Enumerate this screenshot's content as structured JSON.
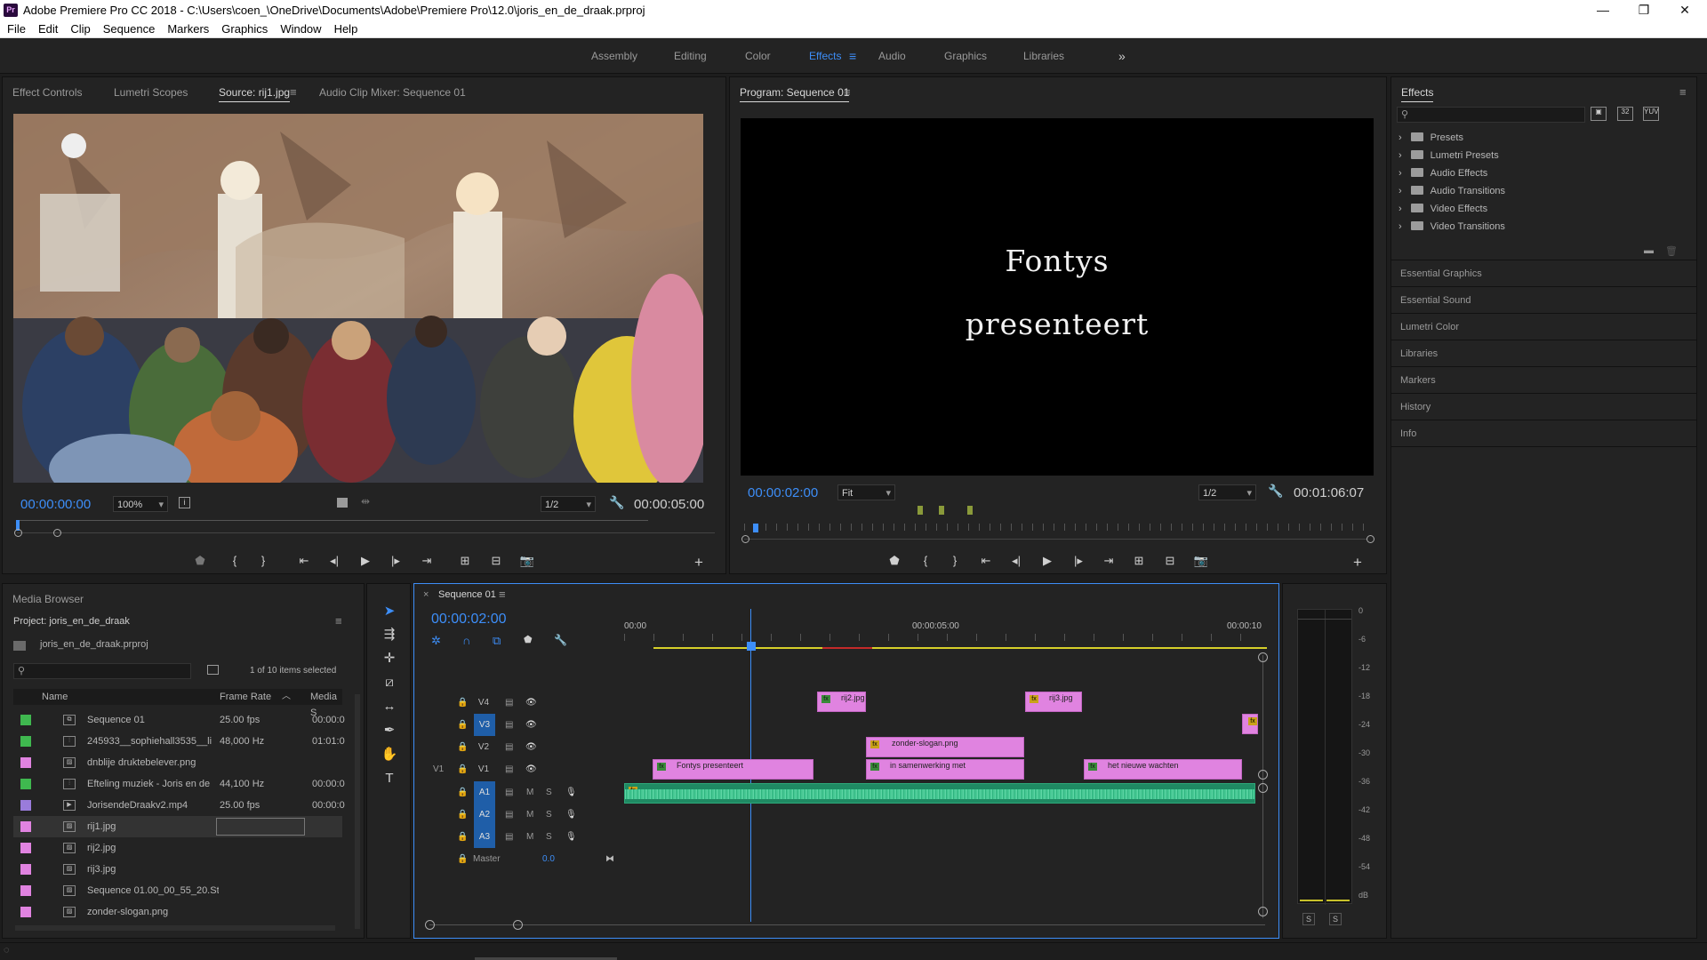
{
  "app": {
    "title": "Adobe Premiere Pro CC 2018 - C:\\Users\\coen_\\OneDrive\\Documents\\Adobe\\Premiere Pro\\12.0\\joris_en_de_draak.prproj",
    "icon_text": "Pr",
    "minimize": "—",
    "maximize": "❐",
    "close": "✕"
  },
  "menu": [
    "File",
    "Edit",
    "Clip",
    "Sequence",
    "Markers",
    "Graphics",
    "Window",
    "Help"
  ],
  "workspaces": [
    "Assembly",
    "Editing",
    "Color",
    "Effects",
    "Audio",
    "Graphics",
    "Libraries"
  ],
  "workspace_active": "Effects",
  "workspace_more": "»",
  "source": {
    "tabs": [
      "Effect Controls",
      "Lumetri Scopes",
      "Source: rij1.jpg",
      "Audio Clip Mixer: Sequence 01"
    ],
    "active_tab": "Source: rij1.jpg",
    "timecode": "00:00:00:00",
    "zoom": "100%",
    "resolution": "1/2",
    "duration": "00:00:05:00"
  },
  "program": {
    "tab": "Program: Sequence 01",
    "line1": "Fontys",
    "line2": "presenteert",
    "timecode": "00:00:02:00",
    "fit": "Fit",
    "resolution": "1/2",
    "duration": "00:01:06:07"
  },
  "effects": {
    "title": "Effects",
    "tree": [
      "Presets",
      "Lumetri Presets",
      "Audio Effects",
      "Audio Transitions",
      "Video Effects",
      "Video Transitions"
    ],
    "sections": [
      "Essential Graphics",
      "Essential Sound",
      "Lumetri Color",
      "Libraries",
      "Markers",
      "History",
      "Info"
    ]
  },
  "project": {
    "tab1": "Media Browser",
    "title": "Project: joris_en_de_draak",
    "file": "joris_en_de_draak.prproj",
    "selected": "1 of 10 items selected",
    "columns": [
      "Name",
      "Frame Rate",
      "Media S"
    ],
    "items": [
      {
        "name": "Sequence 01",
        "rate": "25.00 fps",
        "start": "00:00:0",
        "color": "#3fb84f",
        "icon": "seq"
      },
      {
        "name": "245933__sophiehall3535__li",
        "rate": "48,000 Hz",
        "start": "01:01:0",
        "color": "#3fb84f",
        "icon": "aud"
      },
      {
        "name": "dnblije druktebelever.png",
        "rate": "",
        "start": "",
        "color": "#e083e0",
        "icon": "img"
      },
      {
        "name": "Efteling muziek - Joris en de",
        "rate": "44,100 Hz",
        "start": "00:00:0",
        "color": "#3fb84f",
        "icon": "aud"
      },
      {
        "name": "JorisendeDraakv2.mp4",
        "rate": "25.00 fps",
        "start": "00:00:0",
        "color": "#9a7cdb",
        "icon": "vid"
      },
      {
        "name": "rij1.jpg",
        "rate": "",
        "start": "",
        "color": "#e083e0",
        "icon": "img"
      },
      {
        "name": "rij2.jpg",
        "rate": "",
        "start": "",
        "color": "#e083e0",
        "icon": "img"
      },
      {
        "name": "rij3.jpg",
        "rate": "",
        "start": "",
        "color": "#e083e0",
        "icon": "img"
      },
      {
        "name": "Sequence 01.00_00_55_20.St",
        "rate": "",
        "start": "",
        "color": "#e083e0",
        "icon": "img"
      },
      {
        "name": "zonder-slogan.png",
        "rate": "",
        "start": "",
        "color": "#e083e0",
        "icon": "img"
      }
    ]
  },
  "timeline": {
    "tab": "Sequence 01",
    "timecode": "00:00:02:00",
    "ruler": [
      "00:00",
      "00:00:05:00",
      "00:00:10"
    ],
    "video_tracks": [
      "V4",
      "V3",
      "V2",
      "V1"
    ],
    "audio_tracks": [
      "A1",
      "A2",
      "A3"
    ],
    "source_patch": "V1",
    "master_label": "Master",
    "master_value": "0.0",
    "mute": "M",
    "solo": "S",
    "clips": {
      "v4a": "rij2.jpg",
      "v4b": "rij3.jpg",
      "v2a": "zonder-slogan.png",
      "v1a": "Fontys presenteert",
      "v1b": "in samenwerking met",
      "v1c": "het nieuwe wachten"
    },
    "fx": "fx"
  },
  "meter": {
    "scale": [
      "0",
      "-6",
      "-12",
      "-18",
      "-24",
      "-30",
      "-36",
      "-42",
      "-48",
      "-54",
      "dB"
    ],
    "solo": "S"
  }
}
